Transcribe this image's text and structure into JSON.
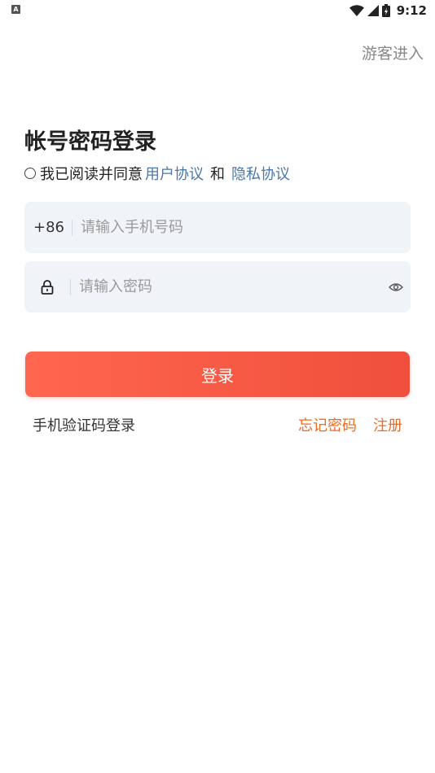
{
  "status_bar": {
    "left_icon_letter": "A",
    "time": "9:12",
    "icons": [
      "wifi-icon",
      "signal-icon",
      "battery-icon"
    ]
  },
  "header": {
    "guest_label": "游客进入"
  },
  "title": "帐号密码登录",
  "agreement": {
    "prefix": "我已阅读并同意",
    "user_agreement": "用户协议",
    "and": "和",
    "privacy_policy": "隐私协议",
    "checked": false
  },
  "phone_field": {
    "country_code": "+86",
    "placeholder": "请输入手机号码",
    "value": ""
  },
  "password_field": {
    "placeholder": "请输入密码",
    "value": ""
  },
  "login_button": {
    "label": "登录"
  },
  "bottom": {
    "sms_login": "手机验证码登录",
    "forgot_password": "忘记密码",
    "register": "注册"
  },
  "colors": {
    "accent_start": "#ff664f",
    "accent_end": "#ef4f3c",
    "link_blue": "#4a77a8",
    "link_orange": "#f26a1a",
    "field_bg": "#f0f3f7"
  }
}
